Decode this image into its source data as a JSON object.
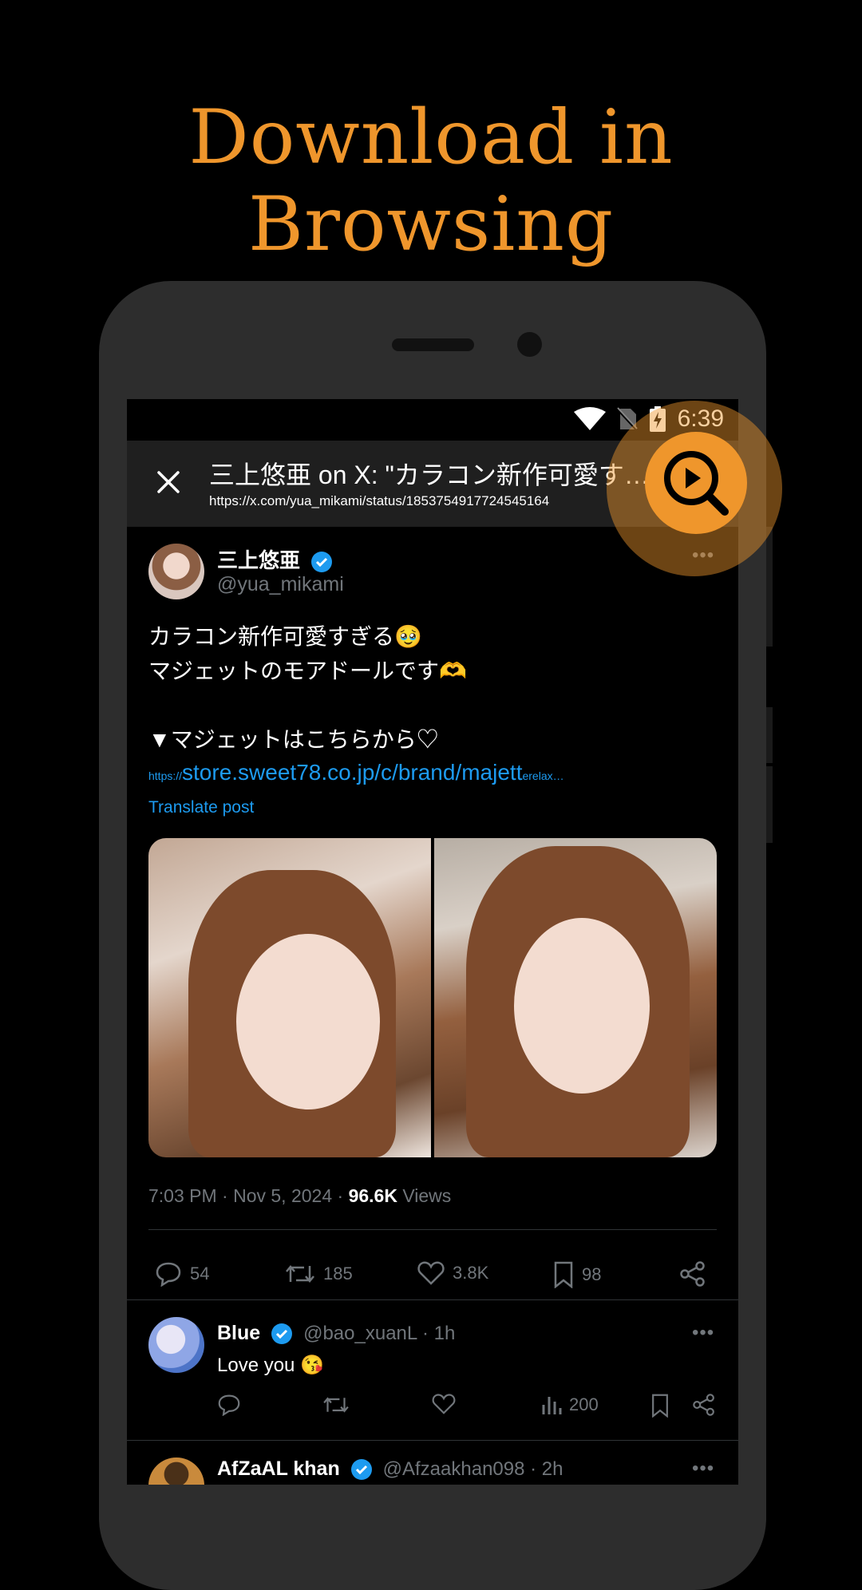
{
  "headline": "Download in Browsing",
  "status_bar": {
    "time": "6:39"
  },
  "browser": {
    "page_title": "三上悠亜 on X: \"カラコン新作可愛す…",
    "url": "https://x.com/yua_mikami/status/1853754917724545164"
  },
  "post": {
    "author_name": "三上悠亜",
    "author_handle": "@yua_mikami",
    "text_lines": [
      "カラコン新作可愛すぎる🥹",
      "マジェットのモアドールです🫶",
      "",
      "▼マジェットはこちらから♡"
    ],
    "link_prefix": "https://",
    "link_main": "store.sweet78.co.jp/c/brand/majett",
    "link_suffix": "erelax…",
    "translate": "Translate post",
    "time": "7:03 PM · Nov 5, 2024 · ",
    "views_count": "96.6K",
    "views_label": " Views",
    "stats": {
      "replies": "54",
      "reposts": "185",
      "likes": "3.8K",
      "bookmarks": "98"
    }
  },
  "replies": [
    {
      "name": "Blue",
      "handle": "@bao_xuanL · 1h",
      "text": "Love you 😘",
      "views": "200"
    },
    {
      "name": "AfZaAL khan",
      "handle": "@Afzaakhan098 · 2h"
    }
  ],
  "colors": {
    "accent": "#ef962c",
    "link": "#1d9bf0",
    "verified": "#1d9bf0",
    "background": "#000000"
  },
  "icons": [
    "wifi-icon",
    "no-sim-icon",
    "battery-charging-icon",
    "close-icon",
    "verified-badge-icon",
    "more-icon",
    "reply-icon",
    "repost-icon",
    "like-icon",
    "bookmark-icon",
    "share-icon",
    "views-icon",
    "download-search-icon"
  ]
}
